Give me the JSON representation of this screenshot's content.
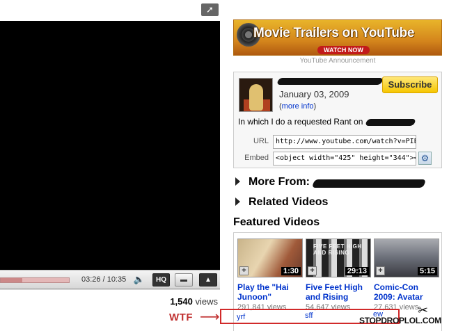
{
  "player": {
    "time": "03:26 / 10:35",
    "hq_label": "HQ",
    "popout_icon": "popout-arrow-icon",
    "progress_fraction": 0.32
  },
  "views": {
    "count": "1,540",
    "suffix": "views"
  },
  "annotation": {
    "wtf": "WTF",
    "arrow": "⟶"
  },
  "banner": {
    "title": "Movie Trailers on YouTube",
    "watch_now": "WATCH NOW",
    "announcement": "YouTube Announcement"
  },
  "info": {
    "date": "January 03, 2009",
    "more_info": "more info",
    "subscribe": "Subscribe",
    "description": "In which I do a requested Rant on",
    "url_label": "URL",
    "url_value": "http://www.youtube.com/watch?v=PIEbH2iv",
    "embed_label": "Embed",
    "embed_value": "<object width=\"425\" height=\"344\"><param"
  },
  "sections": {
    "more_from": "More From:",
    "related": "Related Videos",
    "featured": "Featured Videos"
  },
  "featured": [
    {
      "title": "Play the \"Hai Junoon\"",
      "views": "291,841 views",
      "duration": "1:30",
      "extra": "yrf"
    },
    {
      "title": "Five Feet High and Rising",
      "views": "54,647 views",
      "duration": "29:13",
      "extra": "sff",
      "thumb_text": "FIVE FEET HIGH AND RISING"
    },
    {
      "title": "Comic-Con 2009: Avatar",
      "views": "27,631 views",
      "duration": "5:15",
      "extra": "ew"
    }
  ],
  "logo": {
    "text": "STOPDROPLOL.COM"
  },
  "colors": {
    "link": "#0033cc",
    "subscribe": "#f6c600",
    "annotation": "#d12a2a"
  }
}
